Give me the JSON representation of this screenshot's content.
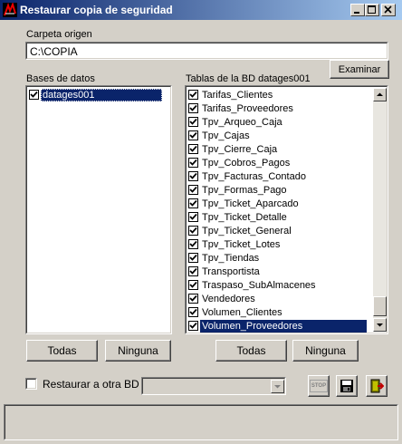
{
  "window": {
    "title": "Restaurar copia de seguridad",
    "controls": [
      "minimize",
      "maximize",
      "close"
    ]
  },
  "origin": {
    "label": "Carpeta origen",
    "value": "C:\\COPIA",
    "browse_button": "Examinar"
  },
  "databases": {
    "label": "Bases de datos",
    "items": [
      {
        "name": "datages001",
        "checked": true,
        "selected": true
      }
    ],
    "select_all": "Todas",
    "select_none": "Ninguna"
  },
  "tables": {
    "label": "Tablas de la BD datages001",
    "items": [
      {
        "name": "Tarifas_Clientes",
        "checked": true
      },
      {
        "name": "Tarifas_Proveedores",
        "checked": true
      },
      {
        "name": "Tpv_Arqueo_Caja",
        "checked": true
      },
      {
        "name": "Tpv_Cajas",
        "checked": true
      },
      {
        "name": "Tpv_Cierre_Caja",
        "checked": true
      },
      {
        "name": "Tpv_Cobros_Pagos",
        "checked": true
      },
      {
        "name": "Tpv_Facturas_Contado",
        "checked": true
      },
      {
        "name": "Tpv_Formas_Pago",
        "checked": true
      },
      {
        "name": "Tpv_Ticket_Aparcado",
        "checked": true
      },
      {
        "name": "Tpv_Ticket_Detalle",
        "checked": true
      },
      {
        "name": "Tpv_Ticket_General",
        "checked": true
      },
      {
        "name": "Tpv_Ticket_Lotes",
        "checked": true
      },
      {
        "name": "Tpv_Tiendas",
        "checked": true
      },
      {
        "name": "Transportista",
        "checked": true
      },
      {
        "name": "Traspaso_SubAlmacenes",
        "checked": true
      },
      {
        "name": "Vendedores",
        "checked": true
      },
      {
        "name": "Volumen_Clientes",
        "checked": true
      },
      {
        "name": "Volumen_Proveedores",
        "checked": true,
        "selected": true
      }
    ],
    "select_all": "Todas",
    "select_none": "Ninguna",
    "scroll_position": 0.92
  },
  "restore_other": {
    "label": "Restaurar a otra BD",
    "checked": false,
    "target_value": ""
  },
  "toolbar": {
    "stop_label": "STOP",
    "save_icon": "floppy-disk-icon",
    "exit_icon": "exit-door-icon"
  },
  "status": {
    "text": ""
  },
  "colors": {
    "title_start": "#0a246a",
    "title_end": "#a6caf0",
    "selection": "#0a246a",
    "face": "#d4d0c8"
  }
}
